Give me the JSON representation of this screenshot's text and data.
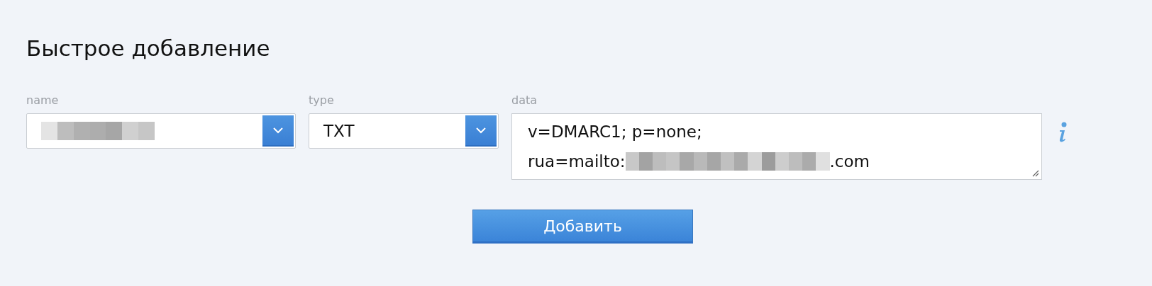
{
  "title": "Быстрое добавление",
  "fields": [
    {
      "kind": "select",
      "label": "name",
      "redacted": true
    },
    {
      "kind": "select",
      "label": "type",
      "value": "TXT",
      "redacted": false
    },
    {
      "kind": "textarea",
      "label": "data",
      "lines": [
        {
          "text": "v=DMARC1; p=none;",
          "redacted_after": false
        },
        {
          "text": "rua=mailto:",
          "redacted_after": true,
          "tail": ".com"
        }
      ]
    }
  ],
  "button": "Добавить"
}
